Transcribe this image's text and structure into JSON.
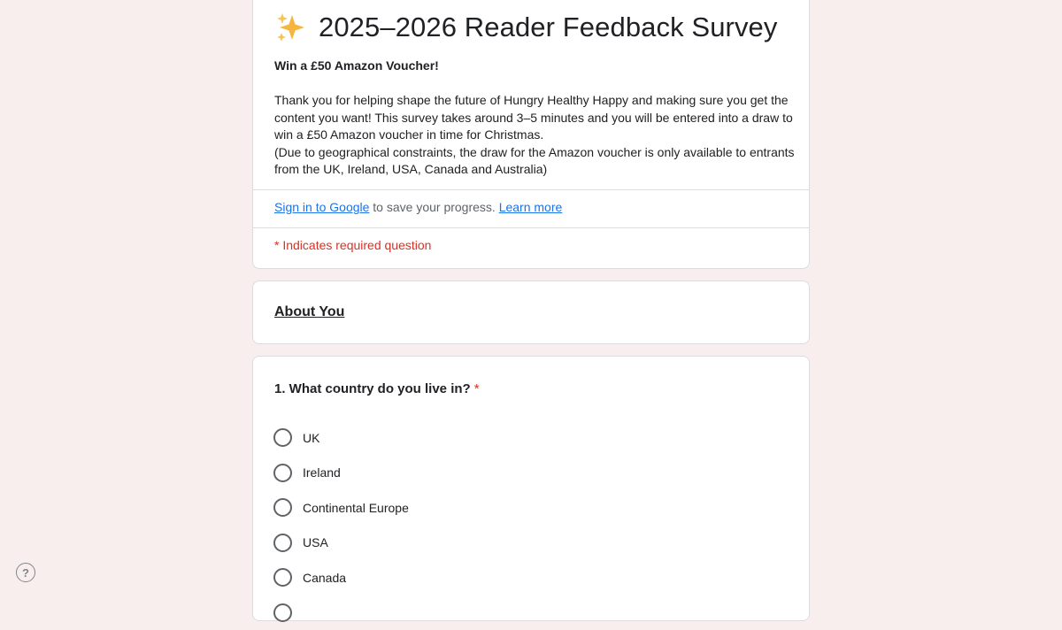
{
  "form": {
    "title": "2025–2026 Reader Feedback Survey",
    "subtitle": "Win a £50 Amazon Voucher!",
    "description_lines": [
      "Thank you for helping shape the future of Hungry Healthy Happy and making sure you get the content you want! This survey takes around 3–5 minutes and you will be entered into a draw to win a £50 Amazon voucher in time for Christmas.",
      "(Due to geographical constraints, the draw for the Amazon voucher is only available to entrants from the UK, Ireland, USA, Canada and Australia)"
    ],
    "signin_link": "Sign in to Google",
    "signin_text": " to save your progress. ",
    "learn_more": "Learn more",
    "required_note": "* Indicates required question",
    "title_icon": "sparkles-icon",
    "accent_color": "#1a73e8",
    "required_color": "#d93025"
  },
  "section": {
    "title": "About You"
  },
  "question": {
    "title": "1. What country do you live in?",
    "required_mark": "*",
    "options": [
      "UK",
      "Ireland",
      "Continental Europe",
      "USA",
      "Canada"
    ]
  },
  "help": {
    "icon": "help-icon",
    "glyph": "?"
  }
}
